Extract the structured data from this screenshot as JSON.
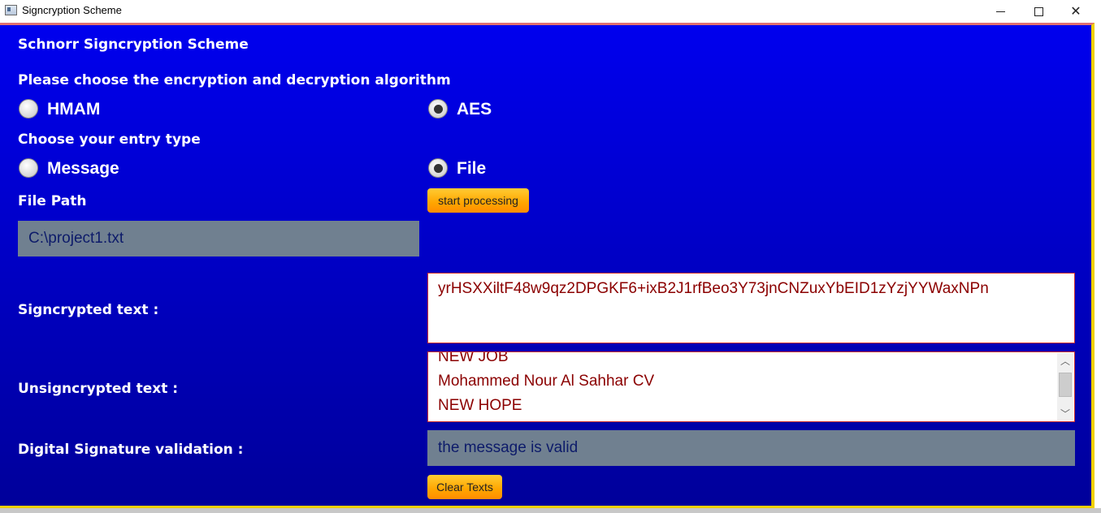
{
  "window": {
    "title": "Signcryption Scheme",
    "minimize_icon": "minimize-icon",
    "maximize_icon": "maximize-icon",
    "close_icon": "close-icon"
  },
  "header": {
    "app_title": "Schnorr Signcryption Scheme",
    "algorithm_prompt": "Please choose the encryption and decryption algorithm",
    "entry_type_prompt": "Choose your entry type"
  },
  "algorithm": {
    "options": [
      {
        "label": "HMAM",
        "selected": false
      },
      {
        "label": "AES",
        "selected": true
      }
    ]
  },
  "entry_type": {
    "options": [
      {
        "label": "Message",
        "selected": false
      },
      {
        "label": "File",
        "selected": true
      }
    ]
  },
  "file_path": {
    "label": "File Path",
    "value": "C:\\project1.txt"
  },
  "actions": {
    "start_label": "start processing",
    "clear_label": "Clear Texts"
  },
  "signcrypted": {
    "label": "Signcrypted text :",
    "value": "yrHSXXiltF48w9qz2DPGKF6+ixB2J1rfBeo3Y73jnCNZuxYbEID1zYzjYYWaxNPn"
  },
  "unsigncrypted": {
    "label": "Unsigncrypted text :",
    "lines": [
      "NEW JOB",
      "Mohammed Nour Al Sahhar CV",
      "NEW HOPE"
    ]
  },
  "validation": {
    "label": "Digital Signature validation :",
    "value": "the message is valid"
  },
  "colors": {
    "background_top": "#0000ee",
    "background_bottom": "#00009a",
    "button_orange": "#ffa500",
    "field_grey": "#708090",
    "output_text": "#8b0000"
  }
}
